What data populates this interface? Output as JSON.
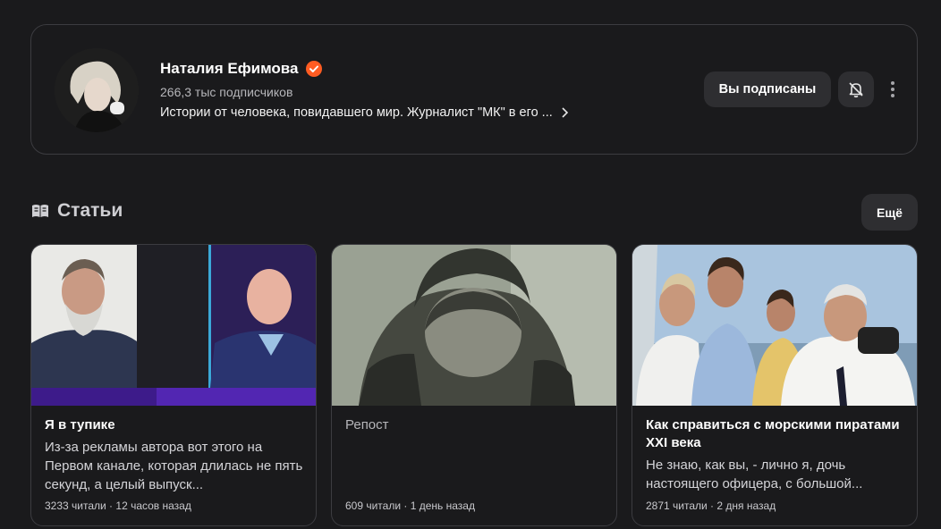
{
  "channel": {
    "name": "Наталия Ефимова",
    "subscribers": "266,3 тыс подписчиков",
    "description": "Истории от человека, повидавшего мир. Журналист \"МК\" в его ...",
    "subscribed_label": "Вы подписаны",
    "verified_color": "#ff5c22",
    "icons": [
      "verified-icon",
      "chevron-right-icon",
      "bell-off-icon",
      "more-vertical-icon"
    ]
  },
  "articles_section": {
    "title": "Статьи",
    "more_label": "Ещё",
    "icon": "articles-icon"
  },
  "articles": [
    {
      "title": "Я в тупике",
      "snippet": "Из-за рекламы автора вот этого на Первом канале, которая длилась не пять секунд, а целый выпуск...",
      "meta": "3233 читали · 12 часов назад"
    },
    {
      "title": "Репост",
      "snippet": "",
      "meta": "609 читали · 1 день назад"
    },
    {
      "title": "Как справиться с морскими пиратами XXI века",
      "snippet": "Не знаю, как вы, - лично я, дочь настоящего офицера, с большой...",
      "meta": "2871 читали · 2 дня назад"
    }
  ]
}
